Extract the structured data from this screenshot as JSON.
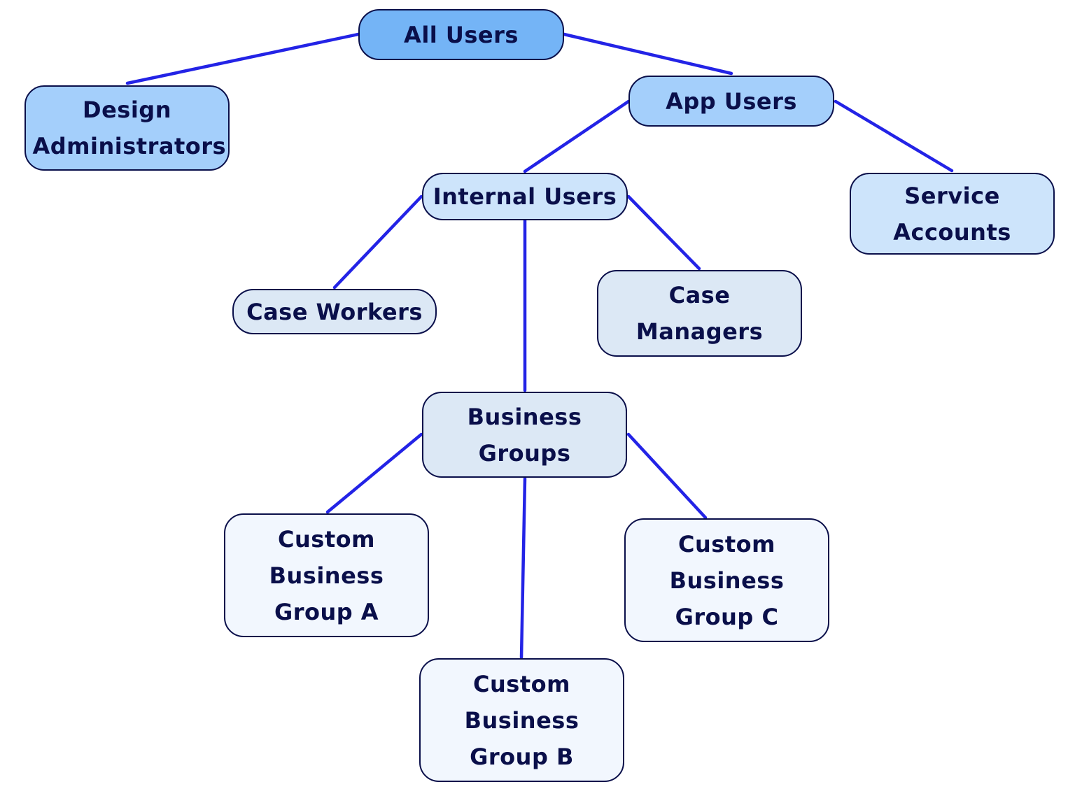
{
  "diagram": {
    "type": "hierarchy",
    "colors": {
      "edge": "#2323e6",
      "border": "#0a0f4a",
      "text": "#0a0f4a"
    },
    "nodes": {
      "all_users": "All Users",
      "design_administrators": "Design Administrators",
      "app_users": "App Users",
      "internal_users": "Internal Users",
      "service_accounts": "Service Accounts",
      "case_workers": "Case Workers",
      "case_managers": "Case Managers",
      "business_groups": "Business Groups",
      "custom_business_group_a": "Custom Business Group A",
      "custom_business_group_b": "Custom Business Group B",
      "custom_business_group_c": "Custom Business Group C"
    },
    "edges": [
      [
        "all_users",
        "design_administrators"
      ],
      [
        "all_users",
        "app_users"
      ],
      [
        "app_users",
        "internal_users"
      ],
      [
        "app_users",
        "service_accounts"
      ],
      [
        "internal_users",
        "case_workers"
      ],
      [
        "internal_users",
        "business_groups"
      ],
      [
        "internal_users",
        "case_managers"
      ],
      [
        "business_groups",
        "custom_business_group_a"
      ],
      [
        "business_groups",
        "custom_business_group_b"
      ],
      [
        "business_groups",
        "custom_business_group_c"
      ]
    ]
  }
}
